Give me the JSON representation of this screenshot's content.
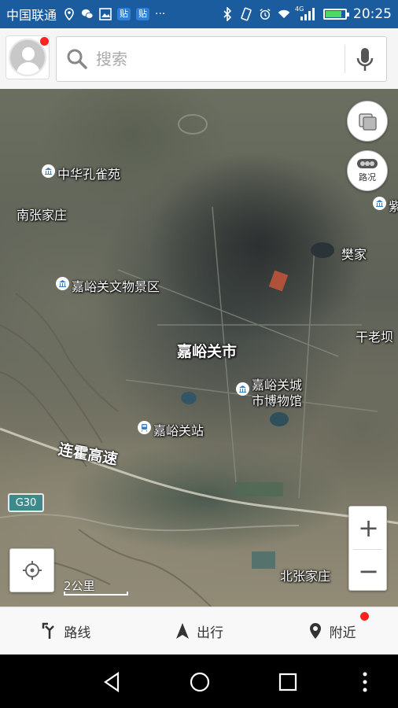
{
  "status_bar": {
    "carrier": "中国联通",
    "tag1": "贴",
    "tag2": "贴",
    "more": "···",
    "network": "4G",
    "time": "20:25",
    "battery_level": 0.85,
    "icons": [
      "location-icon",
      "wechat-icon",
      "gallery-icon",
      "bluetooth-icon",
      "vibrate-icon",
      "alarm-icon",
      "wifi-icon",
      "signal-icon",
      "battery-icon"
    ]
  },
  "header": {
    "avatar": "avatar-icon",
    "search_placeholder": "搜索",
    "search_value": ""
  },
  "map": {
    "labels": {
      "zhonghua_kongque_yuan": "中华孔雀苑",
      "nan_zhang_jia_zhuang": "南张家庄",
      "jiayuguan_wenwu": "嘉峪关文物景区",
      "fan_jia": "樊家",
      "gan_lao_ba": "干老坝",
      "city": "嘉峪关市",
      "museum_line1": "嘉峪关城",
      "museum_line2": "市博物馆",
      "station": "嘉峪关站",
      "highway": "连霍高速",
      "highway_shield": "G30",
      "bei_zhang_jia_zhuang": "北张家庄",
      "edge_poi": "紫"
    },
    "traffic_label": "路况",
    "zoom_in": "+",
    "zoom_out": "−",
    "scale_text": "2公里"
  },
  "bottom_nav": {
    "items": [
      {
        "label": "路线",
        "icon": "route-icon"
      },
      {
        "label": "出行",
        "icon": "navigate-arrow-icon"
      },
      {
        "label": "附近",
        "icon": "nearby-pin-icon"
      }
    ]
  },
  "colors": {
    "status_bar": "#1a5c9e",
    "badge_red": "#ff2222",
    "highway_shield": "#3c8a8a"
  }
}
